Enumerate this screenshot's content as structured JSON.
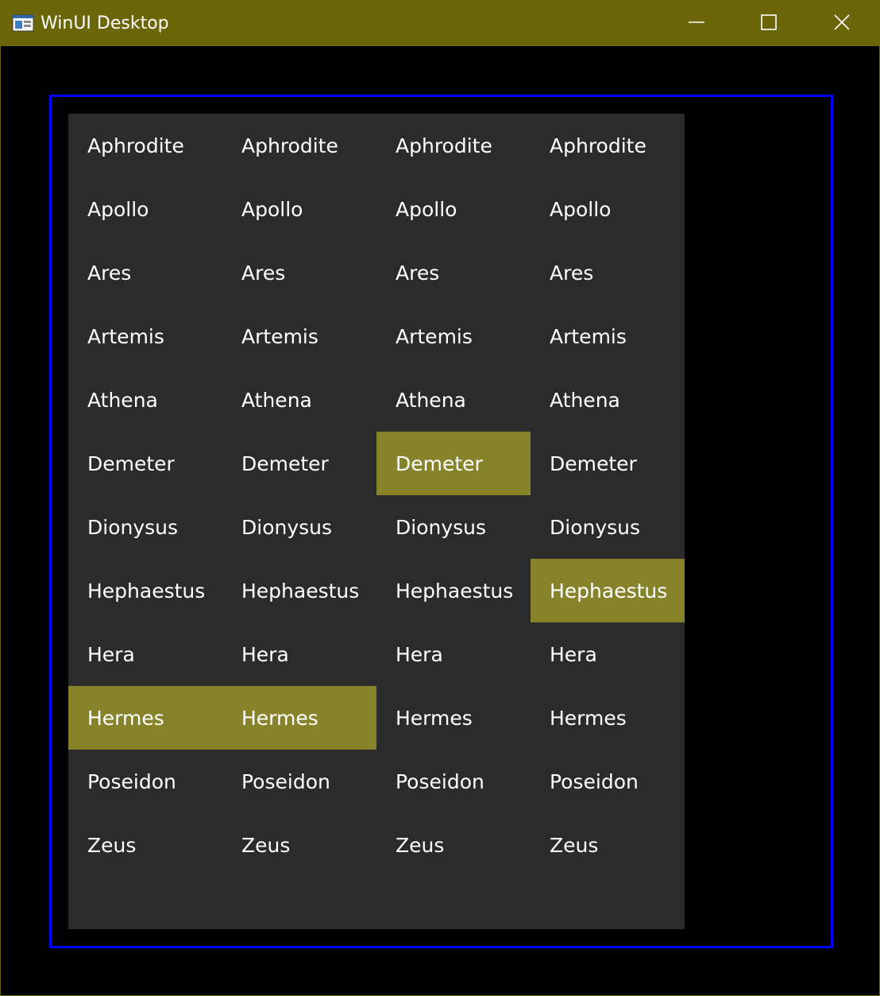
{
  "window": {
    "title": "WinUI Desktop",
    "titlebar_color": "#6b6608",
    "frame_border_color": "#0000ff",
    "panel_color": "#2b2b2b",
    "selection_color": "#87832b",
    "caption_buttons": [
      {
        "name": "minimize",
        "icon": "minimize-icon"
      },
      {
        "name": "maximize",
        "icon": "maximize-icon"
      },
      {
        "name": "close",
        "icon": "close-icon"
      }
    ]
  },
  "grid": {
    "columns": [
      {
        "items": [
          {
            "label": "Aphrodite",
            "selected": false
          },
          {
            "label": "Apollo",
            "selected": false
          },
          {
            "label": "Ares",
            "selected": false
          },
          {
            "label": "Artemis",
            "selected": false
          },
          {
            "label": "Athena",
            "selected": false
          },
          {
            "label": "Demeter",
            "selected": false
          },
          {
            "label": "Dionysus",
            "selected": false
          },
          {
            "label": "Hephaestus",
            "selected": false
          },
          {
            "label": "Hera",
            "selected": false
          },
          {
            "label": "Hermes",
            "selected": true
          },
          {
            "label": "Poseidon",
            "selected": false
          },
          {
            "label": "Zeus",
            "selected": false
          }
        ]
      },
      {
        "items": [
          {
            "label": "Aphrodite",
            "selected": false
          },
          {
            "label": "Apollo",
            "selected": false
          },
          {
            "label": "Ares",
            "selected": false
          },
          {
            "label": "Artemis",
            "selected": false
          },
          {
            "label": "Athena",
            "selected": false
          },
          {
            "label": "Demeter",
            "selected": false
          },
          {
            "label": "Dionysus",
            "selected": false
          },
          {
            "label": "Hephaestus",
            "selected": false
          },
          {
            "label": "Hera",
            "selected": false
          },
          {
            "label": "Hermes",
            "selected": true
          },
          {
            "label": "Poseidon",
            "selected": false
          },
          {
            "label": "Zeus",
            "selected": false
          }
        ]
      },
      {
        "items": [
          {
            "label": "Aphrodite",
            "selected": false
          },
          {
            "label": "Apollo",
            "selected": false
          },
          {
            "label": "Ares",
            "selected": false
          },
          {
            "label": "Artemis",
            "selected": false
          },
          {
            "label": "Athena",
            "selected": false
          },
          {
            "label": "Demeter",
            "selected": true
          },
          {
            "label": "Dionysus",
            "selected": false
          },
          {
            "label": "Hephaestus",
            "selected": false
          },
          {
            "label": "Hera",
            "selected": false
          },
          {
            "label": "Hermes",
            "selected": false
          },
          {
            "label": "Poseidon",
            "selected": false
          },
          {
            "label": "Zeus",
            "selected": false
          }
        ]
      },
      {
        "items": [
          {
            "label": "Aphrodite",
            "selected": false
          },
          {
            "label": "Apollo",
            "selected": false
          },
          {
            "label": "Ares",
            "selected": false
          },
          {
            "label": "Artemis",
            "selected": false
          },
          {
            "label": "Athena",
            "selected": false
          },
          {
            "label": "Demeter",
            "selected": false
          },
          {
            "label": "Dionysus",
            "selected": false
          },
          {
            "label": "Hephaestus",
            "selected": true
          },
          {
            "label": "Hera",
            "selected": false
          },
          {
            "label": "Hermes",
            "selected": false
          },
          {
            "label": "Poseidon",
            "selected": false
          },
          {
            "label": "Zeus",
            "selected": false
          }
        ]
      }
    ]
  }
}
